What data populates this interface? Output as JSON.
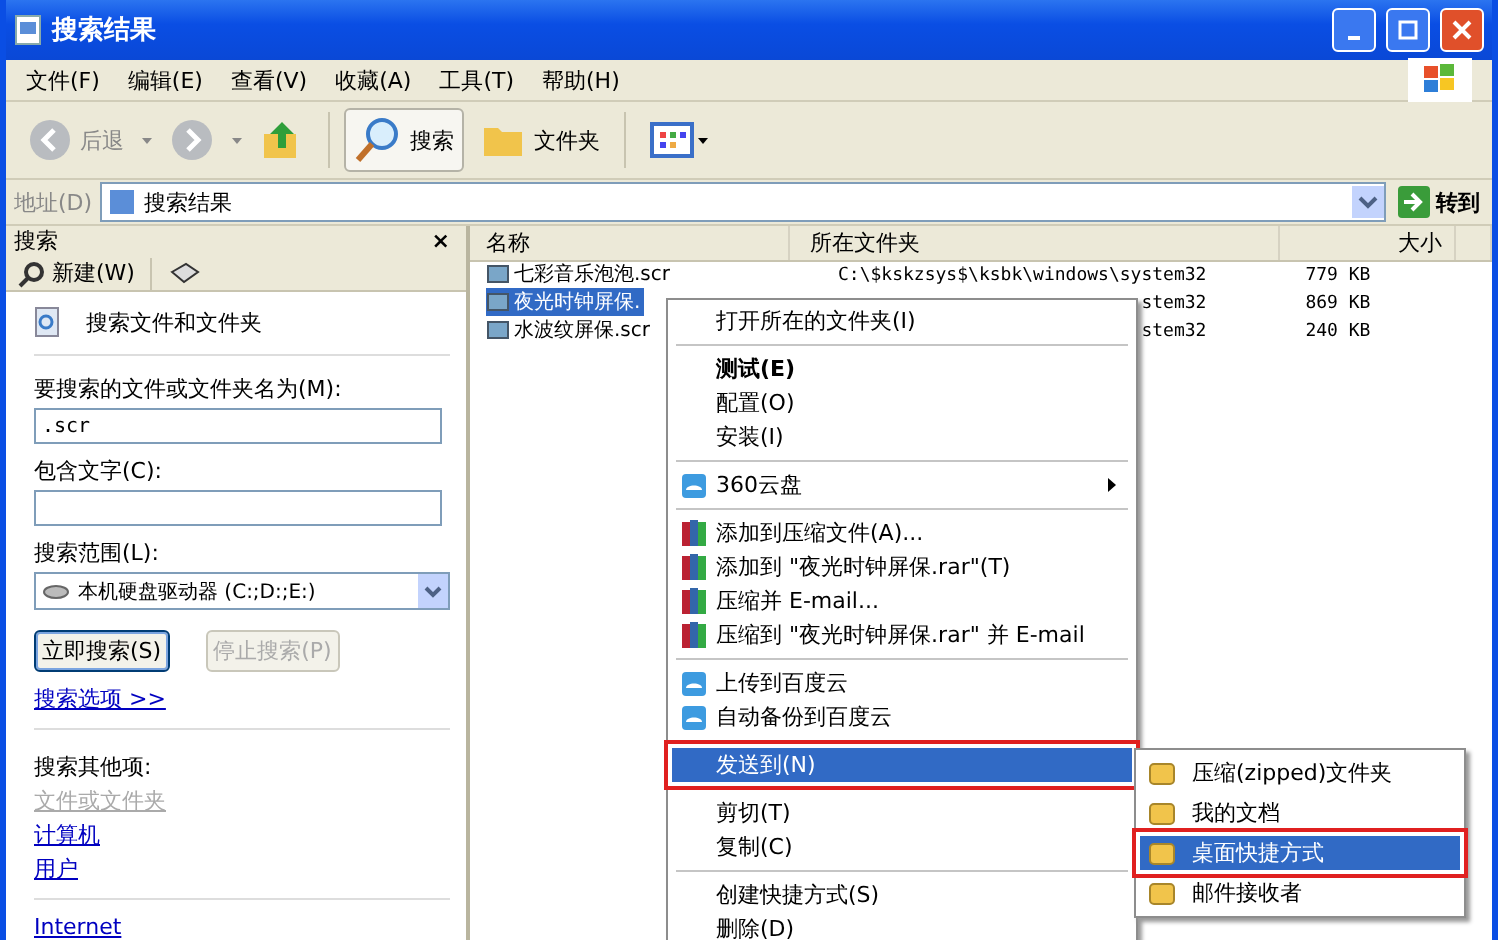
{
  "window": {
    "title": "搜索结果"
  },
  "menu_bar": [
    "文件(F)",
    "编辑(E)",
    "查看(V)",
    "收藏(A)",
    "工具(T)",
    "帮助(H)"
  ],
  "toolbar": {
    "back": "后退",
    "search": "搜索",
    "folders": "文件夹"
  },
  "address_bar": {
    "label": "地址(D)",
    "value": "搜索结果",
    "go": "转到"
  },
  "search_pane": {
    "title": "搜索",
    "close": "×",
    "new_button": "新建(W)",
    "heading": "搜索文件和文件夹",
    "name_label": "要搜索的文件或文件夹名为(M):",
    "name_value": ".scr",
    "text_label": "包含文字(C):",
    "scope_label": "搜索范围(L):",
    "scope_value": "本机硬盘驱动器 (C:;D:;E:)",
    "buttons": [
      {
        "label": "立即搜索(S)",
        "disabled": false
      },
      {
        "label": "停止搜索(P)",
        "disabled": true
      }
    ],
    "options_link": "搜索选项 >>",
    "other_label": "搜索其他项:",
    "other_links": [
      {
        "label": "文件或文件夹",
        "disabled": true
      },
      {
        "label": "计算机",
        "disabled": false
      },
      {
        "label": "用户",
        "disabled": false
      }
    ],
    "internet_link": "Internet"
  },
  "table": {
    "columns": [
      "名称",
      "所在文件夹",
      "大小"
    ],
    "rows": [
      {
        "name": "七彩音乐泡泡.scr",
        "folder": "C:\\$kskzsys$\\ksbk\\windows\\system32",
        "size": "779 KB",
        "selected": false
      },
      {
        "name": "夜光时钟屏保.",
        "folder": "stem32",
        "size": "869 KB",
        "selected": true
      },
      {
        "name": "水波纹屏保.scr",
        "folder": "stem32",
        "size": "240 KB",
        "selected": false
      }
    ]
  },
  "context_menu": [
    {
      "kind": "plain",
      "label": "打开所在的文件夹(I)",
      "bold": false,
      "selected": false
    },
    {
      "kind": "separator"
    },
    {
      "kind": "plain",
      "label": "测试(E)",
      "bold": true,
      "selected": false
    },
    {
      "kind": "plain",
      "label": "配置(O)",
      "bold": false,
      "selected": false
    },
    {
      "kind": "plain",
      "label": "安装(I)",
      "bold": false,
      "selected": false
    },
    {
      "kind": "separator"
    },
    {
      "kind": "cloudsub",
      "label": "360云盘",
      "bold": false,
      "selected": false
    },
    {
      "kind": "separator"
    },
    {
      "kind": "archive",
      "label": "添加到压缩文件(A)...",
      "bold": false,
      "selected": false
    },
    {
      "kind": "archive",
      "label": "添加到 \"夜光时钟屏保.rar\"(T)",
      "bold": false,
      "selected": false
    },
    {
      "kind": "archive",
      "label": "压缩并 E-mail...",
      "bold": false,
      "selected": false
    },
    {
      "kind": "archive",
      "label": "压缩到 \"夜光时钟屏保.rar\" 并 E-mail",
      "bold": false,
      "selected": false
    },
    {
      "kind": "separator"
    },
    {
      "kind": "cloud",
      "label": "上传到百度云",
      "bold": false,
      "selected": false
    },
    {
      "kind": "cloud",
      "label": "自动备份到百度云",
      "bold": false,
      "selected": false
    },
    {
      "kind": "separator"
    },
    {
      "kind": "plain",
      "label": "发送到(N)",
      "bold": false,
      "selected": true,
      "highlighted": true
    },
    {
      "kind": "separator"
    },
    {
      "kind": "plain",
      "label": "剪切(T)",
      "bold": false,
      "selected": false
    },
    {
      "kind": "plain",
      "label": "复制(C)",
      "bold": false,
      "selected": false
    },
    {
      "kind": "separator"
    },
    {
      "kind": "plain",
      "label": "创建快捷方式(S)",
      "bold": false,
      "selected": false
    },
    {
      "kind": "plain",
      "label": "删除(D)",
      "bold": false,
      "selected": false
    }
  ],
  "send_to_menu": [
    {
      "label": "压缩(zipped)文件夹",
      "selected": false
    },
    {
      "label": "我的文档",
      "selected": false
    },
    {
      "label": "桌面快捷方式",
      "selected": true,
      "highlighted": true
    },
    {
      "label": "邮件接收者",
      "selected": false
    }
  ]
}
